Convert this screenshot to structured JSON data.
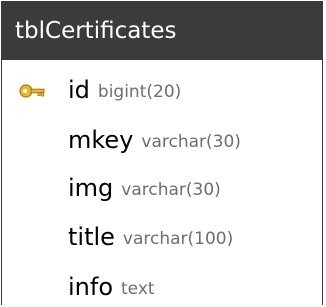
{
  "table": {
    "name": "tblCertificates",
    "columns": [
      {
        "name": "id",
        "type": "bigint(20)",
        "icon": "primary-key-icon"
      },
      {
        "name": "mkey",
        "type": "varchar(30)"
      },
      {
        "name": "img",
        "type": "varchar(30)"
      },
      {
        "name": "title",
        "type": "varchar(100)"
      },
      {
        "name": "info",
        "type": "text"
      }
    ]
  },
  "colors": {
    "header_bg": "#3b3b3b",
    "header_text": "#ffffff",
    "column_name": "#000000",
    "column_type": "#6e6e6e",
    "key_icon": "#d9a520"
  }
}
